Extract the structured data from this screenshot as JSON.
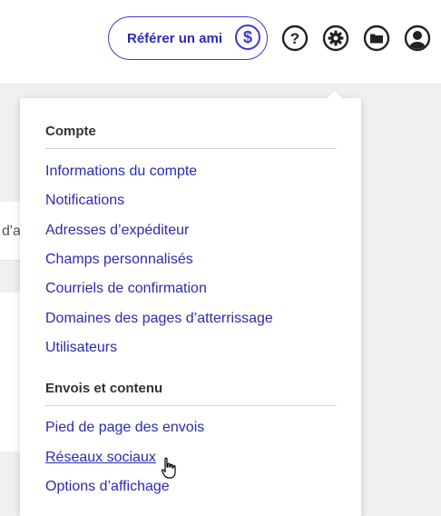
{
  "header": {
    "refer_label": "Référer un ami",
    "refer_symbol": "$",
    "help_symbol": "?"
  },
  "background": {
    "partial_text": "d'a"
  },
  "menu": {
    "section1": {
      "title": "Compte",
      "items": [
        "Informations du compte",
        "Notifications",
        "Adresses d’expéditeur",
        "Champs personnalisés",
        "Courriels de confirmation",
        "Domaines des pages d’atterrissage",
        "Utilisateurs"
      ]
    },
    "section2": {
      "title": "Envois et contenu",
      "items": [
        "Pied de page des envois",
        "Réseaux sociaux",
        "Options d’affichage"
      ]
    }
  },
  "colors": {
    "link": "#2c2ab3",
    "accent": "#3b3ad0",
    "icon": "#222222"
  }
}
